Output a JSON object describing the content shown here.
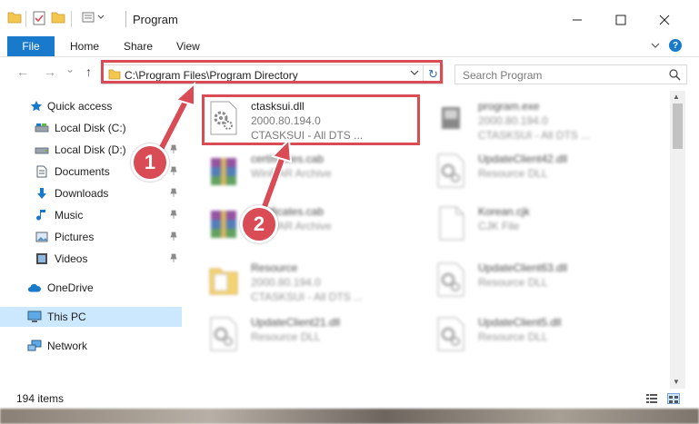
{
  "window": {
    "title": "Program",
    "minimize_glyph": "—",
    "maximize_glyph": "☐",
    "close_glyph": "✕"
  },
  "ribbon": {
    "file": "File",
    "tabs": [
      "Home",
      "Share",
      "View"
    ],
    "help": "?"
  },
  "nav": {
    "back": "←",
    "forward": "→",
    "recent": "⌄",
    "up": "↑",
    "address": "C:\\Program Files\\Program Directory",
    "refresh": "↻",
    "search_placeholder": "Search Program"
  },
  "sidebar": {
    "items": [
      {
        "label": "Quick access",
        "icon": "star-icon",
        "pinned": false
      },
      {
        "label": "Local Disk (C:)",
        "icon": "drive-icon",
        "pinned": true
      },
      {
        "label": "Local Disk (D:)",
        "icon": "drive-icon",
        "pinned": true
      },
      {
        "label": "Documents",
        "icon": "document-icon",
        "pinned": true
      },
      {
        "label": "Downloads",
        "icon": "download-icon",
        "pinned": true
      },
      {
        "label": "Music",
        "icon": "music-icon",
        "pinned": true
      },
      {
        "label": "Pictures",
        "icon": "picture-icon",
        "pinned": true
      },
      {
        "label": "Videos",
        "icon": "video-icon",
        "pinned": true
      },
      {
        "label": "OneDrive",
        "icon": "cloud-icon",
        "pinned": false
      },
      {
        "label": "This PC",
        "icon": "computer-icon",
        "pinned": false,
        "selected": true
      },
      {
        "label": "Network",
        "icon": "network-icon",
        "pinned": false
      }
    ],
    "pin_glyph": "📌"
  },
  "files": [
    {
      "name": "ctasksui.dll",
      "line2": "2000.80.194.0",
      "line3": "CTASKSUI - All DTS ...",
      "icon": "dll-gear-icon",
      "highlighted": true
    },
    {
      "name": "program.exe",
      "line2": "2000.80.194.0",
      "line3": "CTASKSUI - All DTS ...",
      "icon": "exe-icon"
    },
    {
      "name": "certificates.cab",
      "line2": "WinRAR Archive",
      "icon": "winrar-icon"
    },
    {
      "name": "UpdateClient42.dll",
      "line2": "Resource DLL",
      "icon": "dll-gear-icon"
    },
    {
      "name": "certificates.cab",
      "line2": "WinRAR Archive",
      "icon": "winrar-icon"
    },
    {
      "name": "Korean.cjk",
      "line2": "CJK File",
      "icon": "blank-file-icon"
    },
    {
      "name": "Resource",
      "line2": "2000.80.194.0",
      "line3": "CTASKSUI - All DTS ...",
      "icon": "folder-icon"
    },
    {
      "name": "UpdateClient63.dll",
      "line2": "Resource DLL",
      "icon": "dll-gear-icon"
    },
    {
      "name": "UpdateClient21.dll",
      "line2": "Resource DLL",
      "icon": "dll-gear-icon"
    },
    {
      "name": "UpdateClient5.dll",
      "line2": "Resource DLL",
      "icon": "dll-gear-icon"
    }
  ],
  "status": {
    "count": "194 items"
  },
  "annotations": {
    "step1": "1",
    "step2": "2",
    "color": "#d94b55"
  },
  "colors": {
    "accent": "#1979ca",
    "selection": "#cce8ff"
  }
}
